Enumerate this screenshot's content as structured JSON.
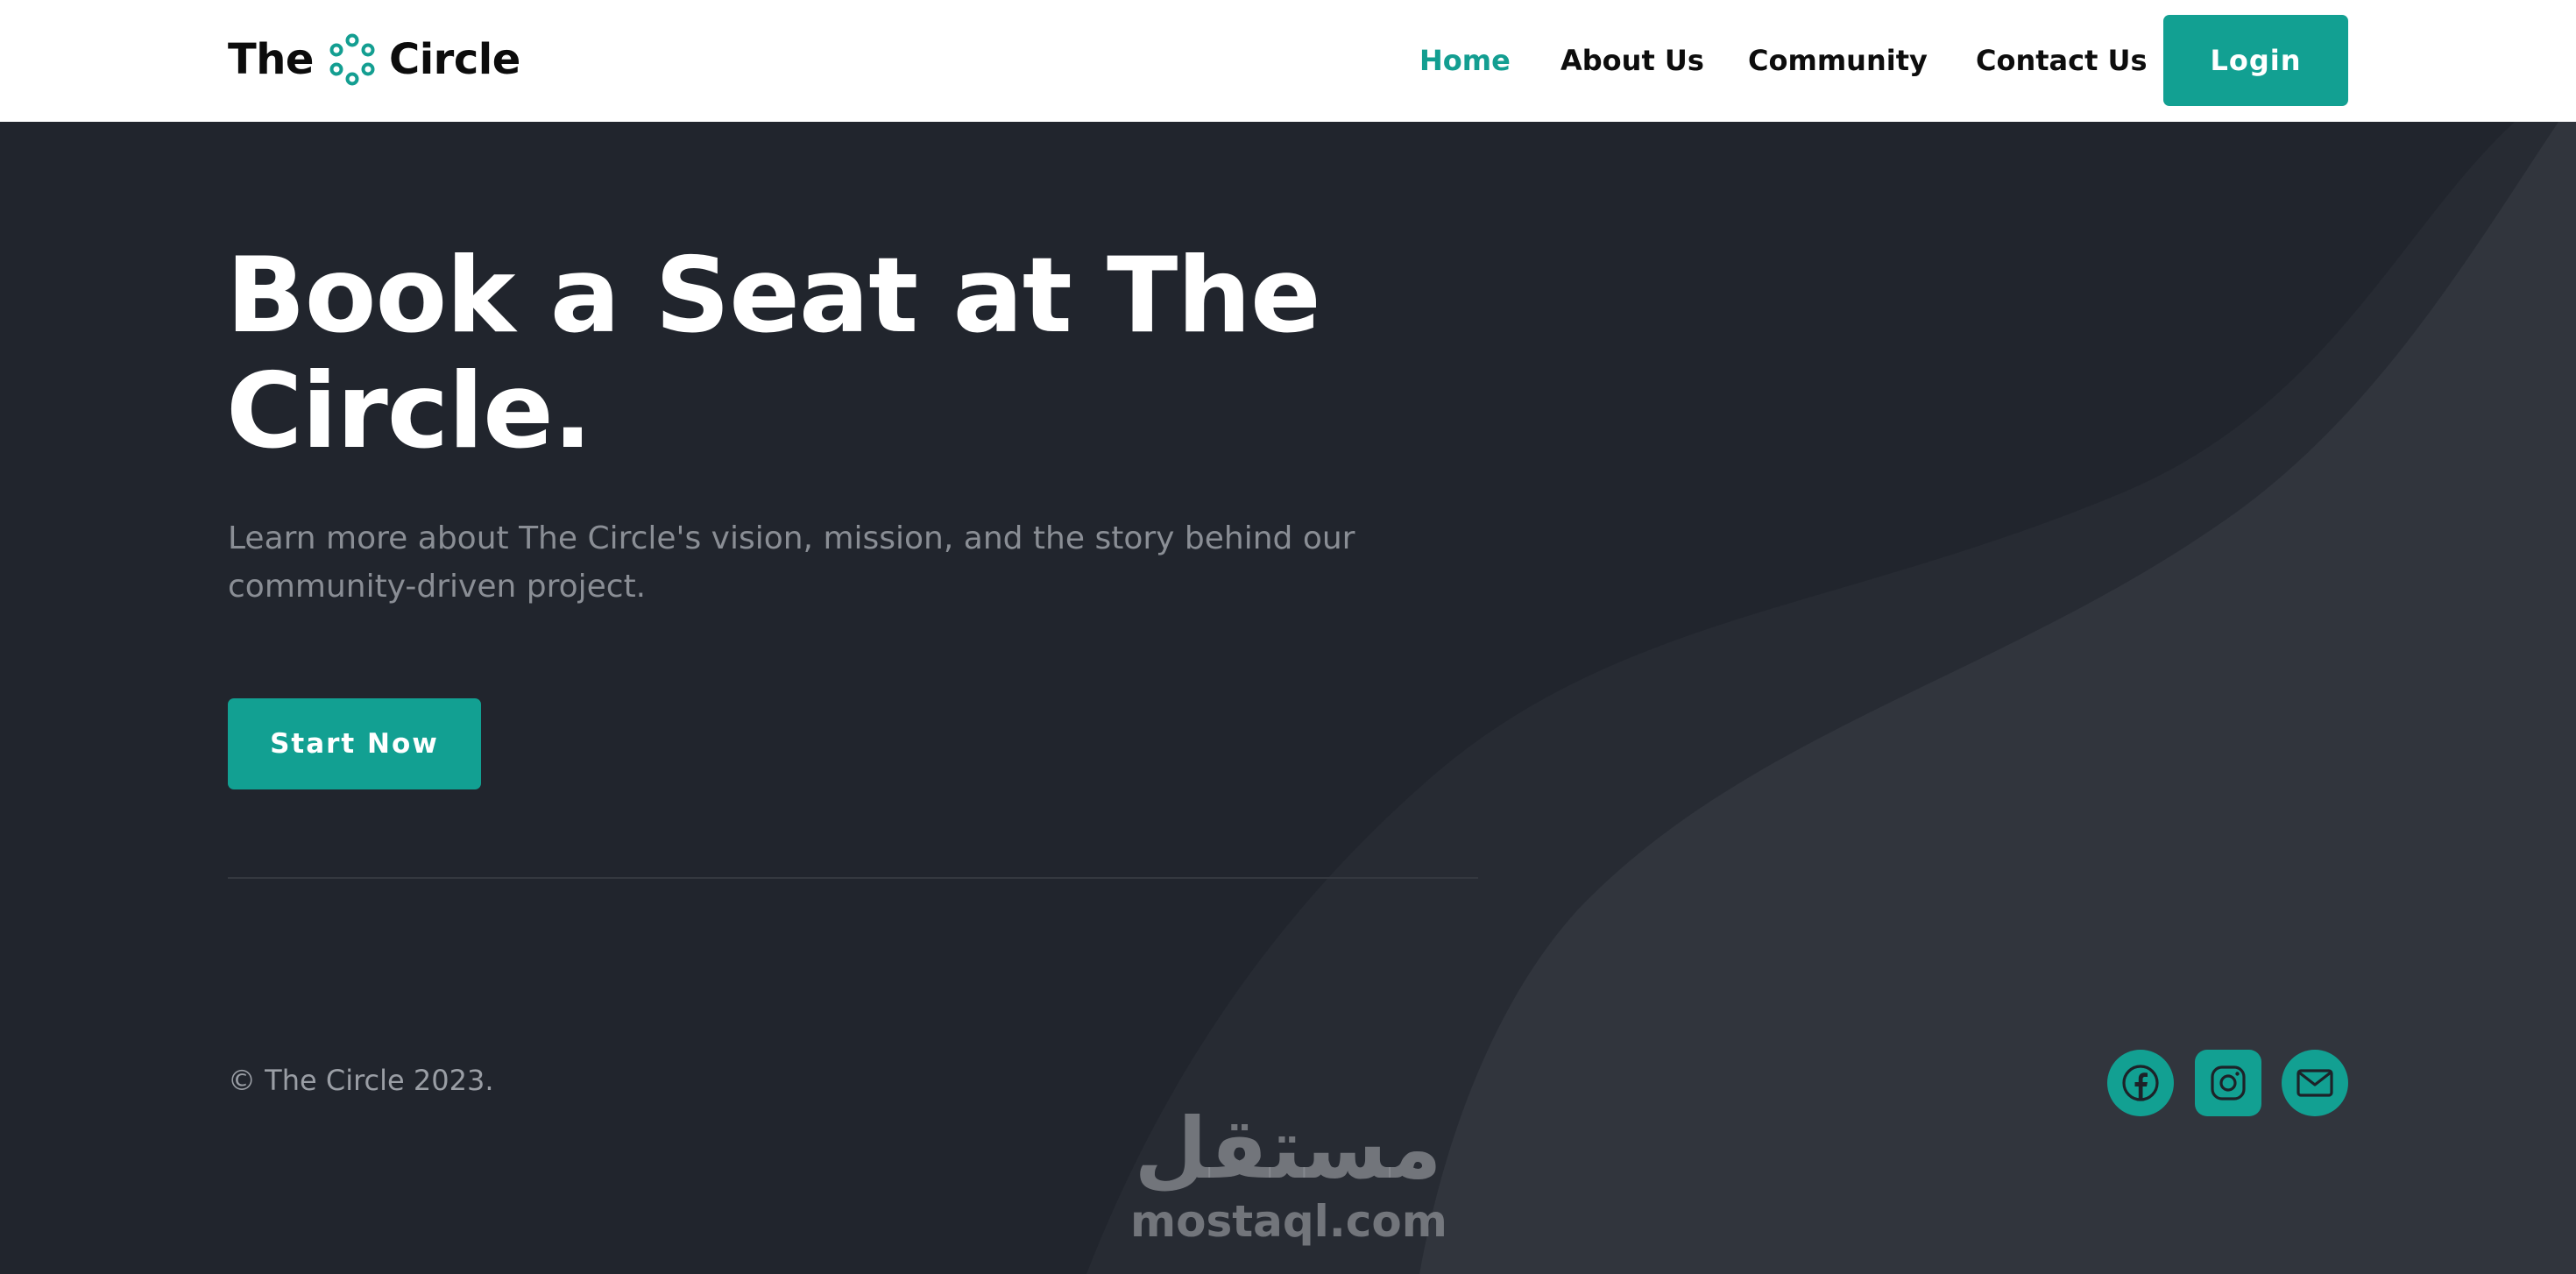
{
  "header": {
    "logo_prefix": "The",
    "logo_suffix": "Circle",
    "nav": [
      {
        "label": "Home",
        "active": true
      },
      {
        "label": "About Us",
        "active": false
      },
      {
        "label": "Community",
        "active": false
      },
      {
        "label": "Contact Us",
        "active": false
      }
    ],
    "login_label": "Login"
  },
  "hero": {
    "title": "Book a Seat at The Circle.",
    "subtitle": "Learn more about The Circle's vision, mission, and the story behind our community-driven project.",
    "cta_label": "Start Now"
  },
  "footer": {
    "copyright": "© The Circle 2023.",
    "social": [
      {
        "icon": "facebook-icon"
      },
      {
        "icon": "instagram-icon"
      },
      {
        "icon": "mail-icon"
      }
    ]
  },
  "watermark": {
    "arabic": "مستقل",
    "latin": "mostaql.com"
  },
  "colors": {
    "accent": "#12a092",
    "accent_text": "#139e91",
    "background": "#21252d",
    "wave": "#2b2f37",
    "header_bg": "#ffffff"
  }
}
